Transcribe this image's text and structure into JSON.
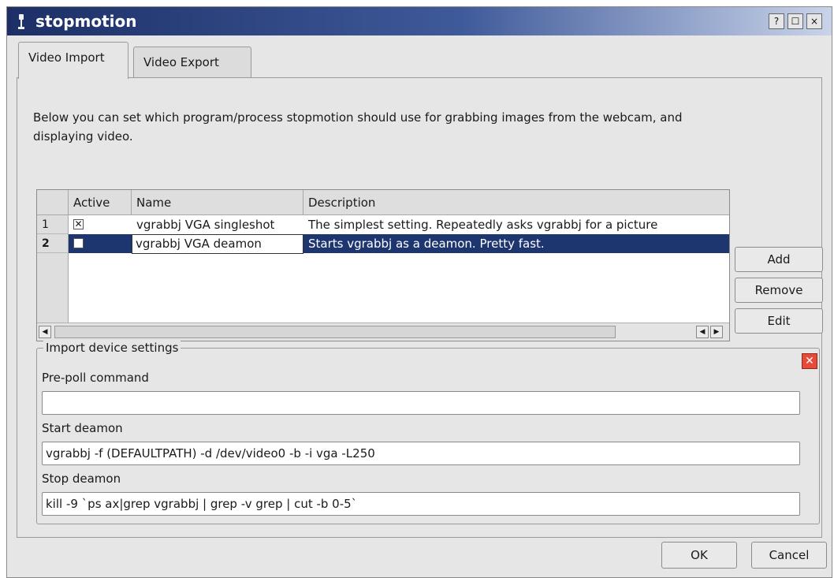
{
  "window": {
    "title": "stopmotion",
    "help_label": "?",
    "maximize_label": "☐",
    "close_label": "×"
  },
  "tabs": [
    {
      "label": "Video Import",
      "mnemonic_char": "I",
      "active": true
    },
    {
      "label": "Video Export",
      "mnemonic_char": "E",
      "active": false
    }
  ],
  "description": "Below you can set which program/process stopmotion should use for grabbing images from the webcam, and displaying video.",
  "table": {
    "headers": [
      "Active",
      "Name",
      "Description"
    ],
    "rows": [
      {
        "number": "1",
        "active_mark": "✕",
        "name": "vgrabbj VGA singleshot",
        "description": "The simplest setting. Repeatedly asks vgrabbj for a picture",
        "selected": false
      },
      {
        "number": "2",
        "active_mark": "",
        "name": "vgrabbj VGA deamon",
        "description": "Starts vgrabbj as a deamon. Pretty fast.",
        "selected": true
      }
    ]
  },
  "side_buttons": [
    {
      "label": "Add",
      "mnemonic_char": "A"
    },
    {
      "label": "Remove",
      "mnemonic_char": "R"
    },
    {
      "label": "Edit",
      "mnemonic_char": "E"
    }
  ],
  "settings": {
    "title": "Import device settings",
    "close_label": "✕",
    "pre_poll_label": "Pre-poll command",
    "pre_poll_value": "",
    "start_label": "Start deamon",
    "start_value": "vgrabbj -f (DEFAULTPATH) -d /dev/video0 -b -i vga -L250",
    "stop_label": "Stop deamon",
    "stop_value": "kill -9 `ps ax|grep vgrabbj | grep -v grep | cut -b 0-5`"
  },
  "footer": {
    "ok_label": "OK",
    "cancel_label": "Cancel"
  },
  "colors": {
    "title_bar": "#1c2f66",
    "selection": "#1e3670",
    "close_red": "#e84a3a"
  }
}
